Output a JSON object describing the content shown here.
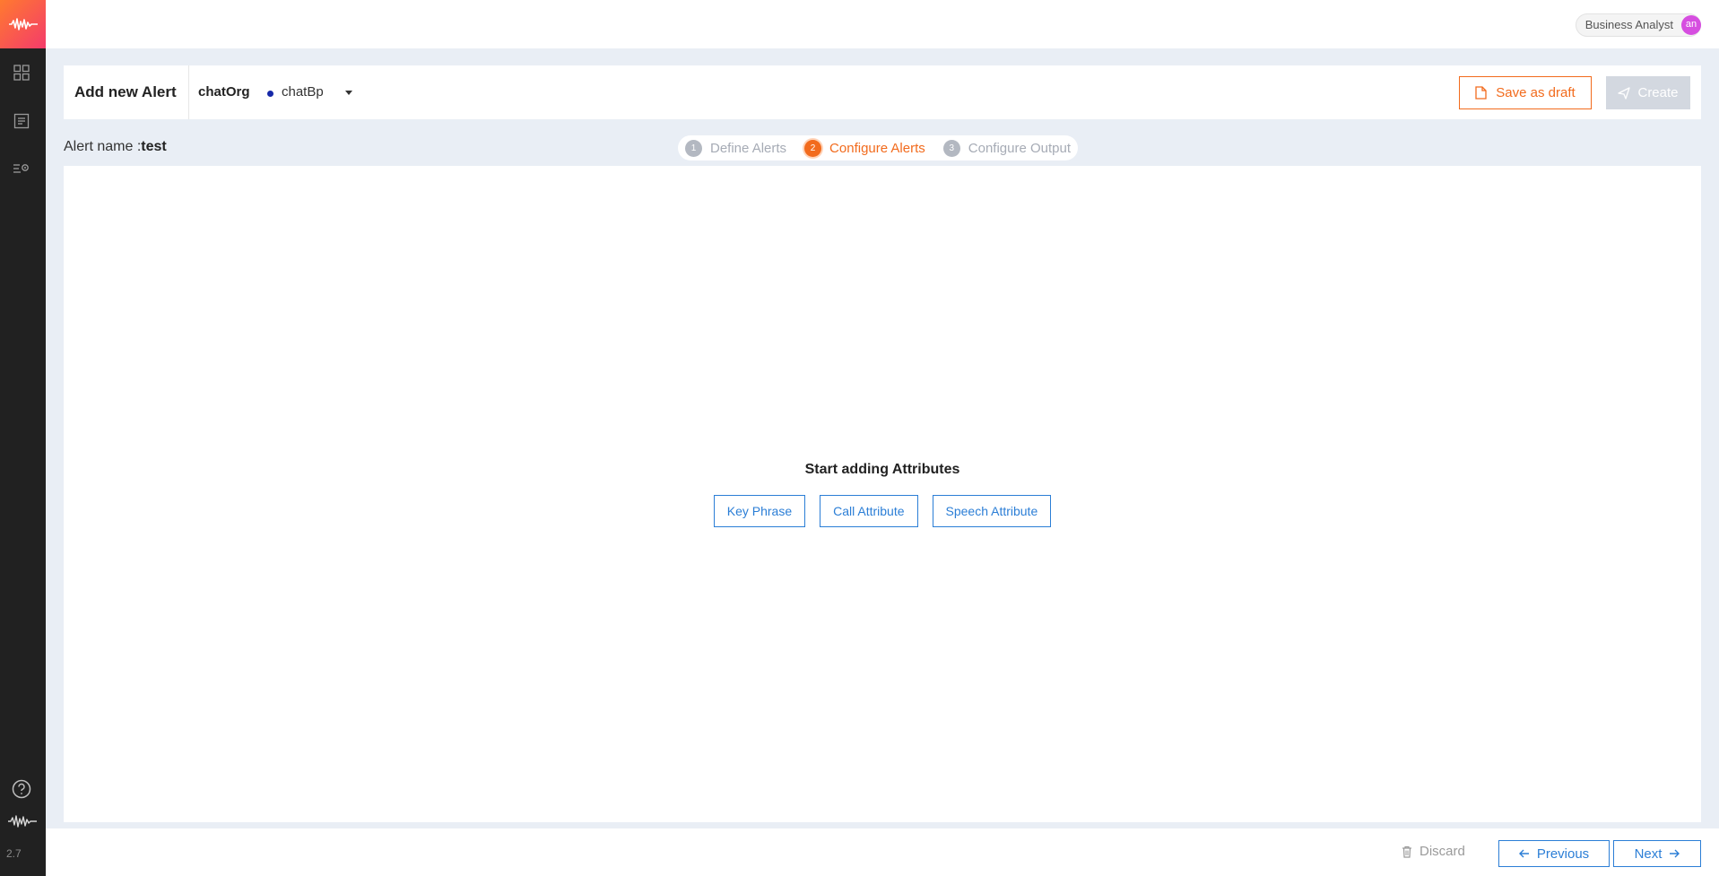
{
  "app": {
    "version": "2.7"
  },
  "sidebar": {
    "items": [
      {
        "icon": "grid-icon"
      },
      {
        "icon": "document-list-icon"
      },
      {
        "icon": "settings-list-icon"
      }
    ],
    "bottom": [
      {
        "icon": "help-icon"
      },
      {
        "icon": "waveform-logo-icon"
      }
    ]
  },
  "topbar": {
    "role": "Business Analyst",
    "avatar_initials": "an"
  },
  "header": {
    "title": "Add new Alert",
    "org": "chatOrg",
    "bp": "chatBp",
    "save_draft_label": "Save as draft",
    "create_label": "Create"
  },
  "alert": {
    "label": "Alert name :",
    "value": "test"
  },
  "stepper": {
    "steps": [
      {
        "num": "1",
        "label": "Define Alerts"
      },
      {
        "num": "2",
        "label": "Configure Alerts"
      },
      {
        "num": "3",
        "label": "Configure Output"
      }
    ],
    "active_index": 1
  },
  "panel": {
    "title": "Start adding Attributes",
    "buttons": [
      "Key Phrase",
      "Call Attribute",
      "Speech Attribute"
    ]
  },
  "footer": {
    "discard_label": "Discard",
    "previous_label": "Previous",
    "next_label": "Next"
  },
  "colors": {
    "accent": "#f26b1d",
    "primary": "#2b7ed6",
    "sidebar_bg": "#212121",
    "page_bg": "#e9eef5"
  }
}
